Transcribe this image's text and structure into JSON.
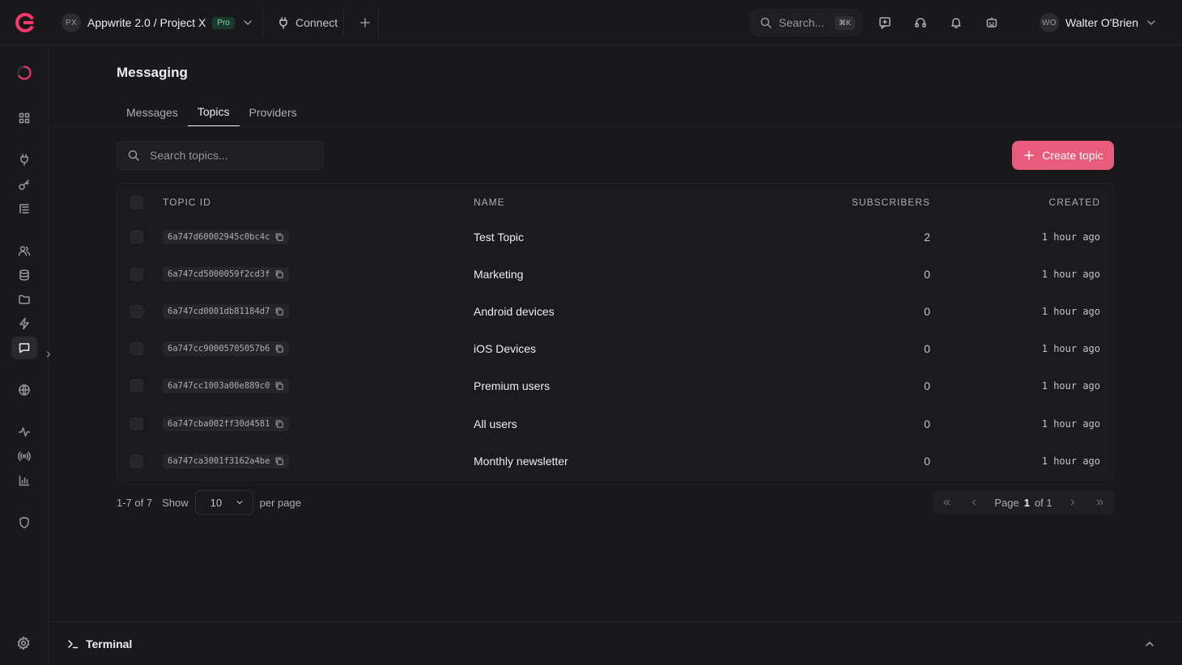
{
  "header": {
    "project_initials": "PX",
    "project_name": "Appwrite 2.0 / Project X",
    "plan_badge": "Pro",
    "connect_label": "Connect",
    "search_label": "Search...",
    "search_shortcut": "⌘K",
    "user_initials": "WO",
    "user_name": "Walter O'Brien"
  },
  "page": {
    "title": "Messaging",
    "tabs": [
      {
        "label": "Messages",
        "active": false
      },
      {
        "label": "Topics",
        "active": true
      },
      {
        "label": "Providers",
        "active": false
      }
    ]
  },
  "toolbar": {
    "search_placeholder": "Search topics...",
    "create_label": "Create topic"
  },
  "table": {
    "columns": [
      "TOPIC ID",
      "NAME",
      "SUBSCRIBERS",
      "CREATED"
    ],
    "rows": [
      {
        "id": "6a747d60002945c0bc4c",
        "name": "Test Topic",
        "subscribers": "2",
        "created": "1 hour ago"
      },
      {
        "id": "6a747cd5000059f2cd3f",
        "name": "Marketing",
        "subscribers": "0",
        "created": "1 hour ago"
      },
      {
        "id": "6a747cd0001db81184d7",
        "name": "Android devices",
        "subscribers": "0",
        "created": "1 hour ago"
      },
      {
        "id": "6a747cc90005705057b6",
        "name": "iOS Devices",
        "subscribers": "0",
        "created": "1 hour ago"
      },
      {
        "id": "6a747cc1003a00e889c0",
        "name": "Premium users",
        "subscribers": "0",
        "created": "1 hour ago"
      },
      {
        "id": "6a747cba002ff30d4581",
        "name": "All users",
        "subscribers": "0",
        "created": "1 hour ago"
      },
      {
        "id": "6a747ca3001f3162a4be",
        "name": "Monthly newsletter",
        "subscribers": "0",
        "created": "1 hour ago"
      }
    ]
  },
  "footer": {
    "range": "1-7 of 7",
    "show_label": "Show",
    "per_page_value": "10",
    "per_page_label": "per page",
    "page_label": "Page",
    "page_current": "1",
    "page_of": "of 1"
  },
  "terminal": {
    "label": "Terminal"
  },
  "colors": {
    "accent": "#fd366e",
    "button": "#e85b7a",
    "background": "#19191c"
  },
  "sidebar_icons": [
    "progress-icon",
    "overview-icon",
    "plug-icon",
    "key-icon",
    "list-icon",
    "users-icon",
    "database-icon",
    "folder-icon",
    "bolt-icon",
    "message-icon",
    "globe-icon",
    "activity-icon",
    "broadcast-icon",
    "chart-icon",
    "shield-icon",
    "settings-icon"
  ]
}
